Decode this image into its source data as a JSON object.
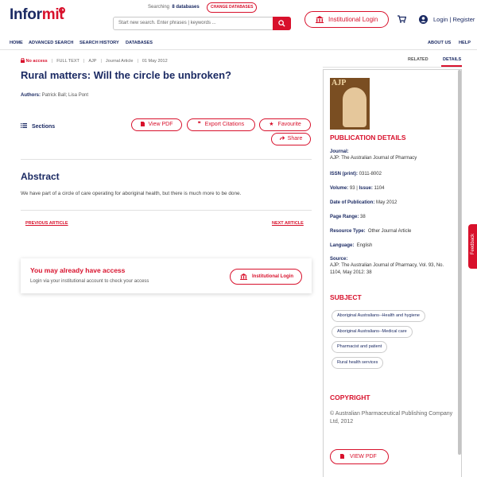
{
  "header": {
    "logo_main": "Infor",
    "logo_accent": "mit",
    "searching_label": "Searching",
    "databases_count": "8 databases",
    "change_databases": "CHANGE DATABASES",
    "search_placeholder": "Start new search. Enter phrases | keywords ...",
    "institutional_login": "Institutional Login",
    "login_register": "Login | Register"
  },
  "nav": {
    "home": "HOME",
    "advanced_search": "ADVANCED SEARCH",
    "search_history": "SEARCH HISTORY",
    "databases": "DATABASES",
    "about_us": "ABOUT US",
    "help": "HELP"
  },
  "article": {
    "access": "No access",
    "full_text": "FULL TEXT",
    "journal_abbr": "AJP",
    "type": "Journal Article",
    "date": "01 May 2012",
    "title": "Rural matters: Will the circle be unbroken?",
    "authors_label": "Authors:",
    "authors": "Patrick Ball; Lisa Pont",
    "sections": "Sections",
    "view_pdf": "View PDF",
    "export_citations": "Export Citations",
    "favourite": "Favourite",
    "share": "Share",
    "abstract_heading": "Abstract",
    "abstract_text": "We have part of a circle of care operating for aboriginal health, but there is much more to be done.",
    "previous": "PREVIOUS ARTICLE",
    "next": "NEXT ARTICLE"
  },
  "access_card": {
    "heading": "You may already have access",
    "text": "Login via your institutional account to check your access",
    "button": "Institutional Login"
  },
  "panel": {
    "tab_related": "RELATED",
    "tab_details": "DETAILS",
    "cover_logo": "AJP",
    "pub_heading": "PUBLICATION DETAILS",
    "journal_label": "Journal:",
    "journal_value": "AJP: The Australian Journal of Pharmacy",
    "issn_label": "ISSN (print):",
    "issn_value": "0311-8002",
    "volume_label": "Volume:",
    "volume_value": "93",
    "issue_label": "Issue:",
    "issue_value": "1104",
    "dop_label": "Date of Publication:",
    "dop_value": "May 2012",
    "pages_label": "Page Range:",
    "pages_value": "38",
    "rtype_label": "Resource Type:",
    "rtype_value": "Other Journal Article",
    "lang_label": "Language:",
    "lang_value": "English",
    "source_label": "Source:",
    "source_value": "AJP: The Australian Journal of Pharmacy, Vol. 93, No. 1104, May 2012: 38",
    "subject_heading": "SUBJECT",
    "subjects": [
      "Aboriginal Australians--Health and hygiene",
      "Aboriginal Australians--Medical care",
      "Pharmacist and patient",
      "Rural health services"
    ],
    "copyright_heading": "COPYRIGHT",
    "copyright_text": "© Australian Pharmaceutical Publishing Company Ltd, 2012",
    "view_pdf": "VIEW PDF"
  },
  "feedback": "Feedback",
  "colors": {
    "brand_red": "#d8112c",
    "navy": "#1b2a63"
  }
}
